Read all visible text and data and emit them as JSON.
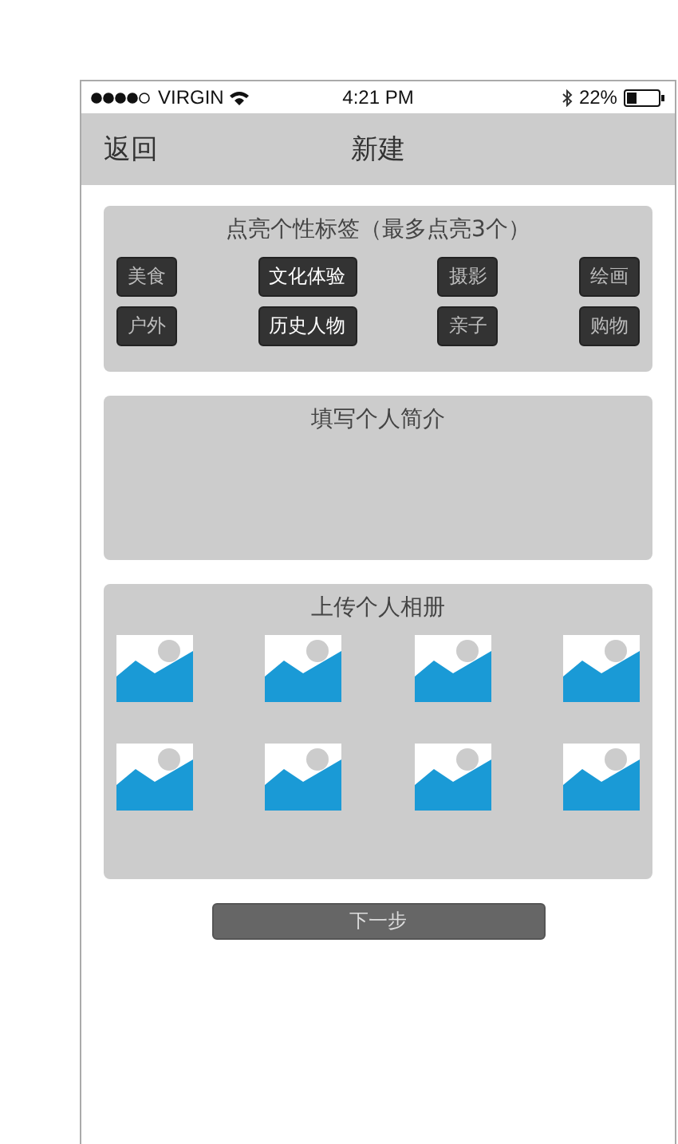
{
  "status_bar": {
    "carrier": "VIRGIN",
    "time": "4:21 PM",
    "battery": "22%"
  },
  "nav_bar": {
    "back": "返回",
    "title": "新建"
  },
  "tags_card": {
    "title": "点亮个性标签（最多点亮3个）",
    "tags": [
      {
        "label": "美食",
        "selected": false
      },
      {
        "label": "文化体验",
        "selected": true
      },
      {
        "label": "摄影",
        "selected": false
      },
      {
        "label": "绘画",
        "selected": false
      },
      {
        "label": "户外",
        "selected": false
      },
      {
        "label": "历史人物",
        "selected": true
      },
      {
        "label": "亲子",
        "selected": false
      },
      {
        "label": "购物",
        "selected": false
      }
    ]
  },
  "intro_card": {
    "title": "填写个人简介"
  },
  "album_card": {
    "title": "上传个人相册",
    "slots": [
      {
        "kind": "placeholder"
      },
      {
        "kind": "placeholder"
      },
      {
        "kind": "placeholder"
      },
      {
        "kind": "placeholder"
      },
      {
        "kind": "placeholder"
      },
      {
        "kind": "placeholder"
      },
      {
        "kind": "placeholder"
      },
      {
        "kind": "placeholder"
      }
    ]
  },
  "next_button": "下一步"
}
